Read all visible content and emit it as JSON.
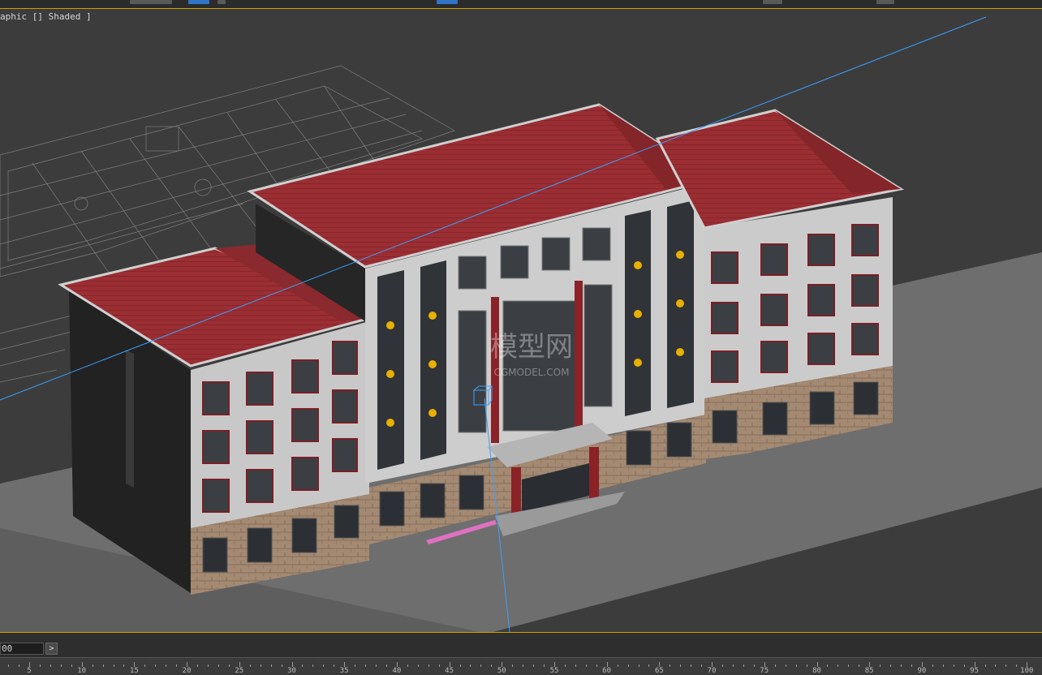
{
  "viewport": {
    "label": "aphic [] Shaded ]",
    "watermark_main": "模型网",
    "watermark_url": "CGMODEL.COM"
  },
  "timeline": {
    "current_frame": "00",
    "next_button": ">",
    "ticks": [
      "5",
      "10",
      "15",
      "20",
      "25",
      "30",
      "35",
      "40",
      "45",
      "50",
      "55",
      "60",
      "65",
      "70",
      "75",
      "80",
      "85",
      "90",
      "95",
      "100"
    ]
  },
  "colors": {
    "viewport_border": "#c8a000",
    "roof": "#9a2f33",
    "wall": "#c9c9c9",
    "brick": "#a08670",
    "selection_axis": "#3aa0ff"
  }
}
